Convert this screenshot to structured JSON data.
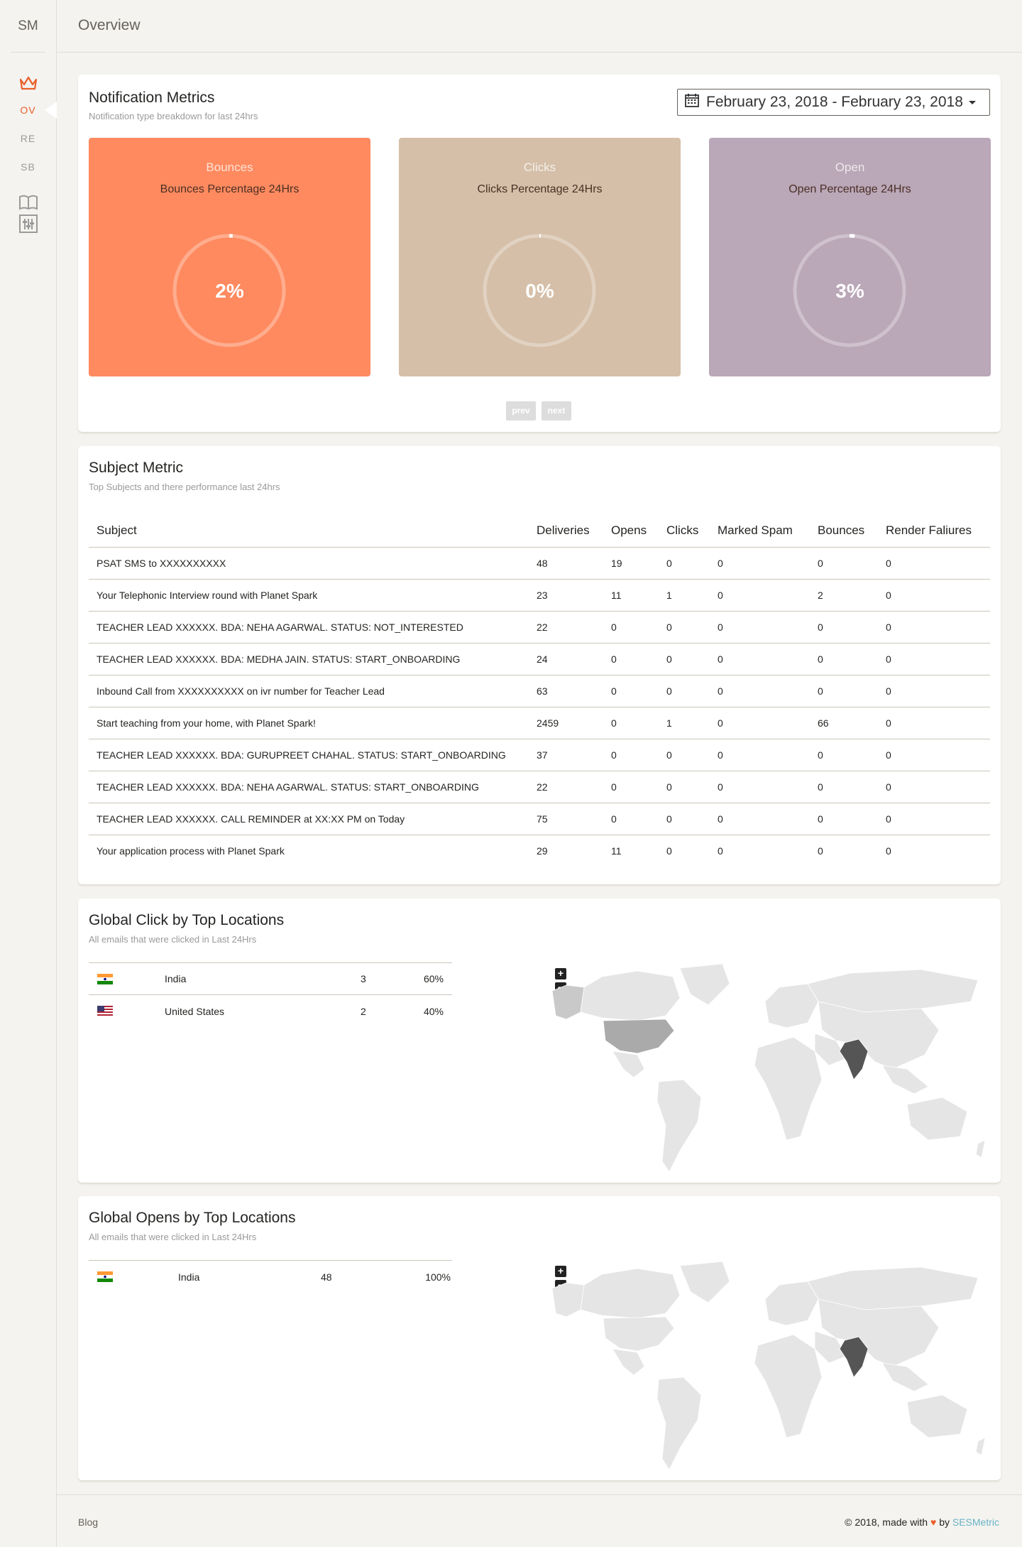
{
  "sidebar": {
    "logo": "SM",
    "items": [
      {
        "label": "OV",
        "active": true
      },
      {
        "label": "RE",
        "active": false
      },
      {
        "label": "SB",
        "active": false
      }
    ]
  },
  "header": {
    "title": "Overview"
  },
  "notification_metrics": {
    "title": "Notification Metrics",
    "subtitle": "Notification type breakdown for last 24hrs",
    "date_range": "February 23, 2018 - February 23, 2018",
    "cards": [
      {
        "name": "Bounces",
        "desc": "Bounces Percentage 24Hrs",
        "value": "2%",
        "percent": 2,
        "color": "#ff8a5f"
      },
      {
        "name": "Clicks",
        "desc": "Clicks Percentage 24Hrs",
        "value": "0%",
        "percent": 0,
        "color": "#d5bfa8"
      },
      {
        "name": "Open",
        "desc": "Open Percentage 24Hrs",
        "value": "3%",
        "percent": 3,
        "color": "#baa7b8"
      }
    ],
    "prev_label": "prev",
    "next_label": "next"
  },
  "subject_metric": {
    "title": "Subject Metric",
    "subtitle": "Top Subjects and there performance last 24hrs",
    "columns": [
      "Subject",
      "Deliveries",
      "Opens",
      "Clicks",
      "Marked Spam",
      "Bounces",
      "Render Faliures"
    ],
    "rows": [
      [
        "PSAT SMS to XXXXXXXXXX",
        "48",
        "19",
        "0",
        "0",
        "0",
        "0"
      ],
      [
        "Your Telephonic Interview round with Planet Spark",
        "23",
        "11",
        "1",
        "0",
        "2",
        "0"
      ],
      [
        "TEACHER LEAD XXXXXX. BDA: NEHA AGARWAL. STATUS: NOT_INTERESTED",
        "22",
        "0",
        "0",
        "0",
        "0",
        "0"
      ],
      [
        "TEACHER LEAD XXXXXX. BDA: MEDHA JAIN. STATUS: START_ONBOARDING",
        "24",
        "0",
        "0",
        "0",
        "0",
        "0"
      ],
      [
        "Inbound Call from XXXXXXXXXX on ivr number for Teacher Lead",
        "63",
        "0",
        "0",
        "0",
        "0",
        "0"
      ],
      [
        "Start teaching from your home, with Planet Spark!",
        "2459",
        "0",
        "1",
        "0",
        "66",
        "0"
      ],
      [
        "TEACHER LEAD XXXXXX. BDA: GURUPREET CHAHAL. STATUS: START_ONBOARDING",
        "37",
        "0",
        "0",
        "0",
        "0",
        "0"
      ],
      [
        "TEACHER LEAD XXXXXX. BDA: NEHA AGARWAL. STATUS: START_ONBOARDING",
        "22",
        "0",
        "0",
        "0",
        "0",
        "0"
      ],
      [
        "TEACHER LEAD XXXXXX. CALL REMINDER at XX:XX PM on Today",
        "75",
        "0",
        "0",
        "0",
        "0",
        "0"
      ],
      [
        "Your application process with Planet Spark",
        "29",
        "11",
        "0",
        "0",
        "0",
        "0"
      ]
    ]
  },
  "global_clicks": {
    "title": "Global Click by Top Locations",
    "subtitle": "All emails that were clicked in Last 24Hrs",
    "rows": [
      {
        "flag": "india-flag",
        "country": "India",
        "count": "3",
        "percent": "60%"
      },
      {
        "flag": "us-flag",
        "country": "United States",
        "count": "2",
        "percent": "40%"
      }
    ]
  },
  "global_opens": {
    "title": "Global Opens by Top Locations",
    "subtitle": "All emails that were clicked in Last 24Hrs",
    "rows": [
      {
        "flag": "india-flag",
        "country": "India",
        "count": "48",
        "percent": "100%"
      }
    ]
  },
  "map": {
    "zoom_in": "+",
    "zoom_out": "−"
  },
  "footer": {
    "blog": "Blog",
    "copy_prefix": "© 2018, made with",
    "by": "by",
    "brand": "SESMetric"
  }
}
